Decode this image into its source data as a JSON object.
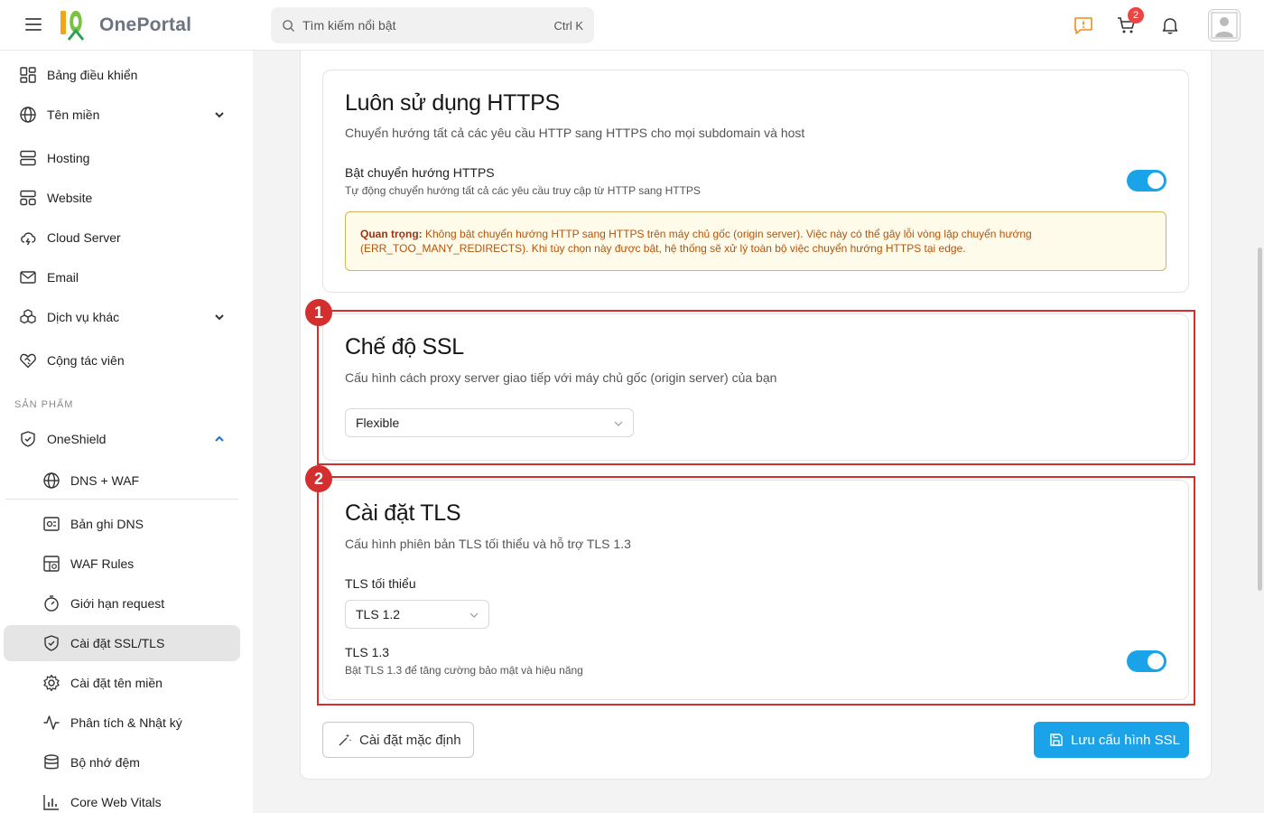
{
  "brand": {
    "name": "OnePortal",
    "logo_mark": "10"
  },
  "search": {
    "placeholder": "Tìm kiếm nổi bật",
    "shortcut": "Ctrl K"
  },
  "header": {
    "cart_count": "2",
    "accent_color": "#1aa3e8"
  },
  "sidebar": {
    "items": [
      {
        "label": "Bảng điều khiển"
      },
      {
        "label": "Tên miền"
      },
      {
        "label": "Hosting"
      },
      {
        "label": "Website"
      },
      {
        "label": "Cloud Server"
      },
      {
        "label": "Email"
      },
      {
        "label": "Dịch vụ khác"
      },
      {
        "label": "Cộng tác viên"
      }
    ],
    "section_label": "SẢN PHẨM",
    "product": {
      "label": "OneShield"
    },
    "sub_items": [
      {
        "label": "DNS + WAF"
      },
      {
        "label": "Bản ghi DNS"
      },
      {
        "label": "WAF Rules"
      },
      {
        "label": "Giới hạn request"
      },
      {
        "label": "Cài đặt SSL/TLS"
      },
      {
        "label": "Cài đặt tên miền"
      },
      {
        "label": "Phân tích & Nhật ký"
      },
      {
        "label": "Bộ nhớ đệm"
      },
      {
        "label": "Core Web Vitals"
      }
    ]
  },
  "https_card": {
    "title": "Luôn sử dụng HTTPS",
    "description": "Chuyển hướng tất cả các yêu cầu HTTP sang HTTPS cho mọi subdomain và host",
    "toggle_label": "Bật chuyển hướng HTTPS",
    "toggle_hint": "Tự động chuyển hướng tất cả các yêu cầu truy cập từ HTTP sang HTTPS",
    "toggle_on": true,
    "warning_title": "Quan trọng:",
    "warning_text": " Không bật chuyển hướng HTTP sang HTTPS trên máy chủ gốc (origin server). Việc này có thể gây lỗi vòng lặp chuyển hướng (ERR_TOO_MANY_REDIRECTS). Khi tùy chọn này được bật, hệ thống sẽ xử lý toàn bộ việc chuyển hướng HTTPS tại edge."
  },
  "ssl_card": {
    "marker": "1",
    "title": "Chế độ SSL",
    "description": "Cấu hình cách proxy server giao tiếp với máy chủ gốc (origin server) của bạn",
    "mode_value": "Flexible"
  },
  "tls_card": {
    "marker": "2",
    "title": "Cài đặt TLS",
    "description": "Cấu hình phiên bản TLS tối thiểu và hỗ trợ TLS 1.3",
    "min_label": "TLS tối thiểu",
    "min_value": "TLS 1.2",
    "tls13_label": "TLS 1.3",
    "tls13_hint": "Bật TLS 1.3 để tăng cường bảo mật và hiệu năng",
    "tls13_on": true
  },
  "actions": {
    "reset_label": "Cài đặt mặc định",
    "save_label": "Lưu cấu hình SSL"
  }
}
